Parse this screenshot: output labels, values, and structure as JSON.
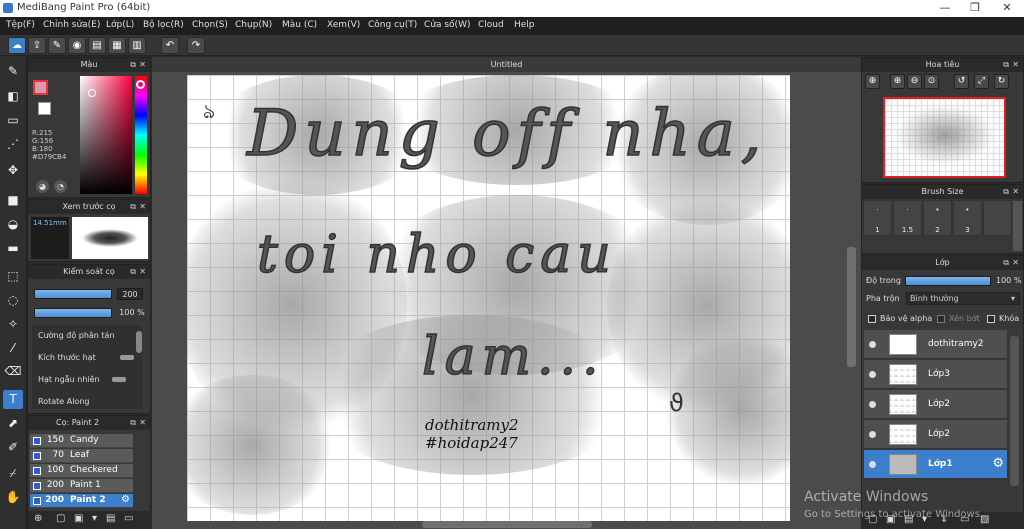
{
  "window": {
    "title": "MediBang Paint Pro (64bit)",
    "minimize": "—",
    "maximize": "❐",
    "close": "✕"
  },
  "menu": [
    "Tệp(F)",
    "Chỉnh sửa(E)",
    "Lớp(L)",
    "Bộ lọc(R)",
    "Chọn(S)",
    "Chụp(N)",
    "Màu (C)",
    "Xem(V)",
    "Công cụ(T)",
    "Cửa số(W)",
    "Cloud",
    "Help"
  ],
  "color_panel": {
    "title": "Màu",
    "r": "R:215",
    "g": "G:156",
    "b": "B:180",
    "hex": "#D79CB4",
    "color": "#D79CB4"
  },
  "brush_preview": {
    "title": "Xem trước cọ",
    "size": "14.51mm"
  },
  "brush_control": {
    "title": "Kiểm soát cọ",
    "size_value": "200",
    "opacity_value": "100 %",
    "options": [
      "Cường độ phân tán",
      "Kích thước hạt",
      "Hạt ngẫu nhiên",
      "Rotate Along"
    ]
  },
  "brush_list": {
    "title": "Cọ: Paint 2",
    "items": [
      {
        "size": "150",
        "name": "Candy"
      },
      {
        "size": "70",
        "name": "Leaf"
      },
      {
        "size": "100",
        "name": "Checkered"
      },
      {
        "size": "200",
        "name": "Paint 1"
      },
      {
        "size": "200",
        "name": "Paint 2"
      }
    ]
  },
  "document": {
    "tab_title": "Untitled",
    "line1": "Dung off nha,",
    "line2": "toi nho cau",
    "line3": "lam...",
    "sig1": "dothitramy2",
    "sig2": "#hoidap247"
  },
  "navigator": {
    "title": "Hoa tiêu"
  },
  "brush_size": {
    "title": "Brush Size",
    "sizes": [
      "1",
      "1.5",
      "2",
      "3"
    ]
  },
  "layers": {
    "title": "Lớp",
    "opacity_label": "Độ trong",
    "opacity_value": "100 %",
    "blend_label": "Pha trộn",
    "blend_value": "Bình thường",
    "protect_alpha": "Bảo vệ alpha",
    "clipping": "Xén bớt",
    "lock": "Khóa",
    "items": [
      {
        "name": "dothitramy2"
      },
      {
        "name": "Lớp3"
      },
      {
        "name": "Lớp2"
      },
      {
        "name": "Lớp2"
      },
      {
        "name": "Lớp1"
      }
    ]
  },
  "watermark": {
    "line1": "Activate Windows",
    "line2": "Go to Settings to activate Windows."
  }
}
